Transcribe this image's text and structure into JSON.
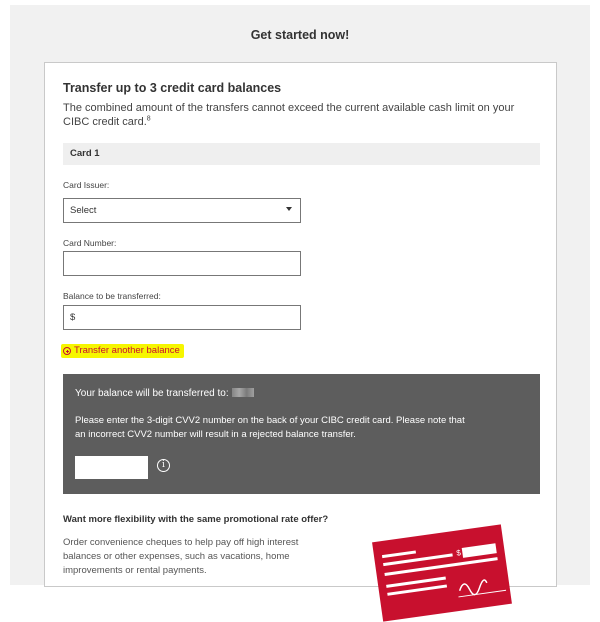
{
  "page": {
    "title": "Get started now!"
  },
  "transfer": {
    "heading": "Transfer up to 3 credit card balances",
    "description": "The combined amount of the transfers cannot exceed the current available cash limit on your CIBC credit card.",
    "footnote": "8"
  },
  "card": {
    "header": "Card 1",
    "issuer_label": "Card Issuer:",
    "issuer_value": "Select",
    "number_label": "Card Number:",
    "number_value": "",
    "balance_label": "Balance to be transferred:",
    "balance_value": "$"
  },
  "transfer_another": {
    "label": "Transfer another balance"
  },
  "cvv": {
    "line1": "Your balance will be transferred to:",
    "desc": "Please enter the 3-digit CVV2 number on the back of your CIBC credit card. Please note that an incorrect CVV2 number will result in a rejected balance transfer.",
    "info_glyph": "i"
  },
  "promo": {
    "heading": "Want more flexibility with the same promotional rate offer?",
    "desc": "Order convenience cheques to help pay off high interest balances or other expenses, such as vacations, home improvements or rental payments."
  },
  "colors": {
    "brand": "#c8102e",
    "highlight": "#f6f600",
    "cvv_bg": "#5d5d5d"
  }
}
